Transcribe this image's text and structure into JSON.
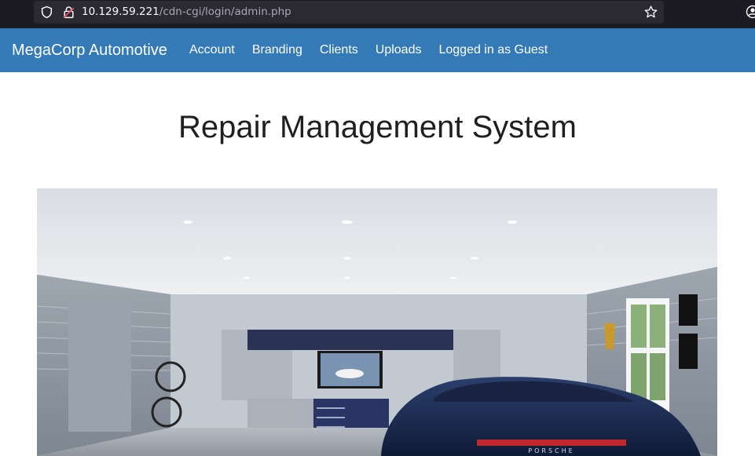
{
  "browser": {
    "url_host": "10.129.59.221",
    "url_path": "/cdn-cgi/login/admin.php",
    "icons": [
      "shield-icon",
      "insecure-lock-icon",
      "bookmark-star-icon",
      "account-icon"
    ]
  },
  "navbar": {
    "brand": "MegaCorp Automotive",
    "links": [
      "Account",
      "Branding",
      "Clients",
      "Uploads",
      "Logged in as Guest"
    ],
    "background": "#337ab7"
  },
  "main": {
    "title": "Repair Management System",
    "hero_image": {
      "subject": "garage interior with blue sports car",
      "car_badge": "PORSCHE"
    }
  }
}
